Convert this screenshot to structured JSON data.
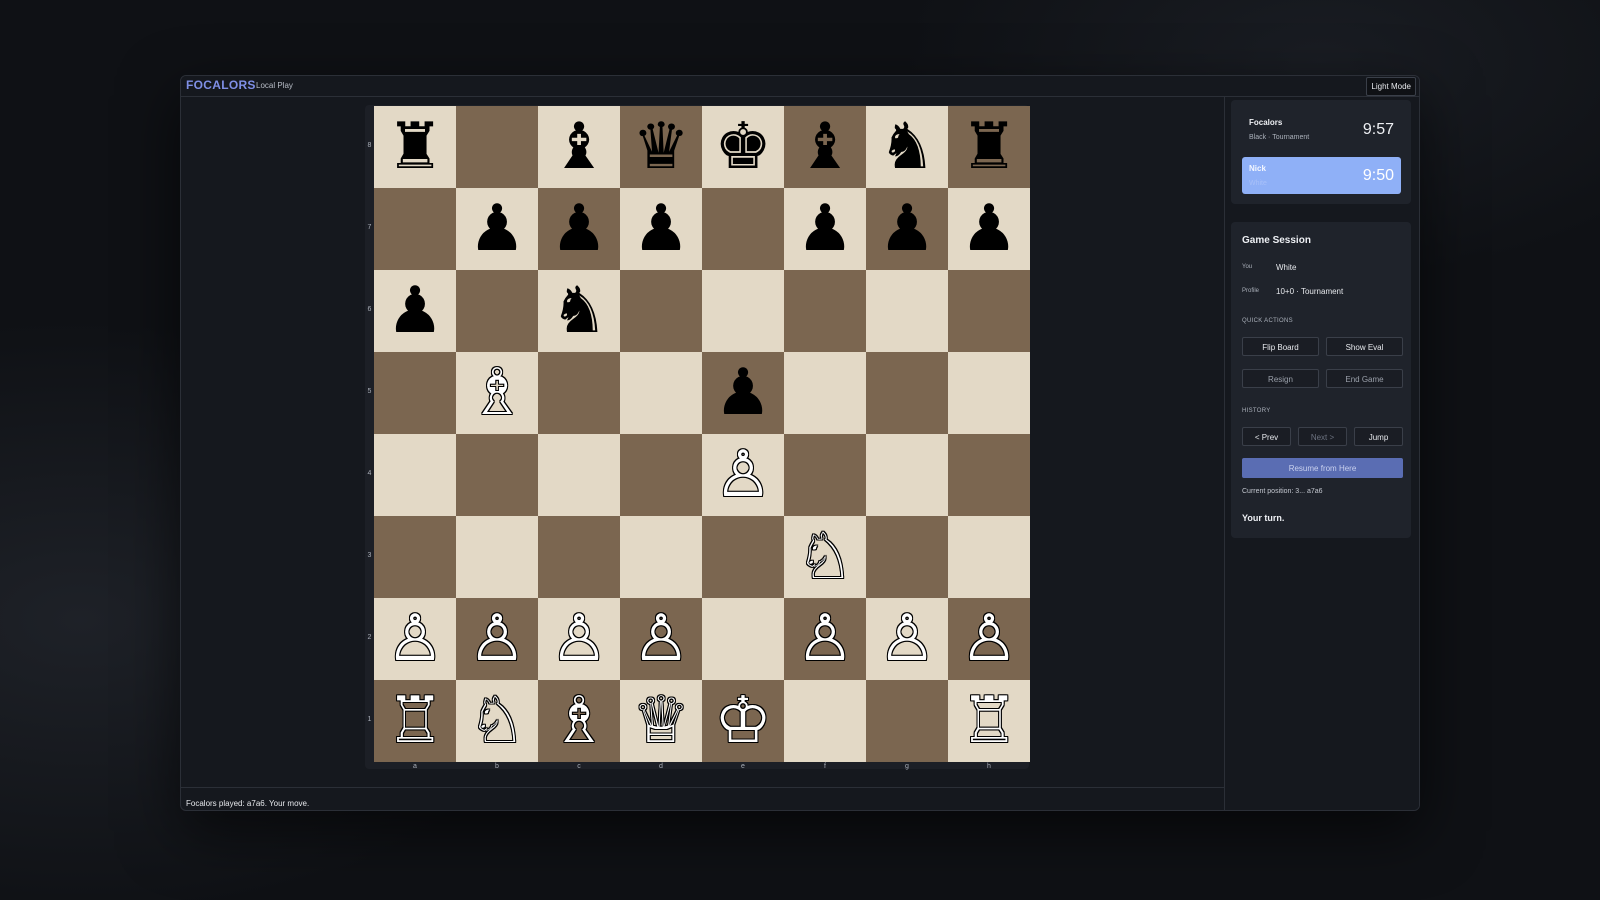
{
  "header": {
    "brand": "FOCALORS",
    "mode": "Local Play",
    "theme_toggle": "Light Mode"
  },
  "board": {
    "rows": [
      [
        "♜",
        "",
        "♝",
        "♛",
        "♚",
        "♝",
        "♞",
        "♜"
      ],
      [
        "",
        "♟",
        "♟",
        "♟",
        "",
        "♟",
        "♟",
        "♟"
      ],
      [
        "♟",
        "",
        "♞",
        "",
        "",
        "",
        "",
        ""
      ],
      [
        "",
        "♗",
        "",
        "",
        "♟",
        "",
        "",
        ""
      ],
      [
        "",
        "",
        "",
        "",
        "♙",
        "",
        "",
        ""
      ],
      [
        "",
        "",
        "",
        "",
        "",
        "♘",
        "",
        ""
      ],
      [
        "♙",
        "♙",
        "♙",
        "♙",
        "",
        "♙",
        "♙",
        "♙"
      ],
      [
        "♖",
        "♘",
        "♗",
        "♕",
        "♔",
        "",
        "",
        "♖"
      ]
    ],
    "ranks": [
      "8",
      "7",
      "6",
      "5",
      "4",
      "3",
      "2",
      "1"
    ],
    "files": [
      "a",
      "b",
      "c",
      "d",
      "e",
      "f",
      "g",
      "h"
    ],
    "light_color": "#e3d9c6",
    "dark_color": "#7b6650"
  },
  "status_message": "Focalors played: a7a6. Your move.",
  "clocks": {
    "opponent": {
      "name": "Focalors",
      "subtitle": "Black · Tournament",
      "time": "9:57"
    },
    "player": {
      "name": "Nick",
      "subtitle": "White",
      "time": "9:50"
    }
  },
  "session": {
    "title": "Game Session",
    "you_label": "You",
    "you_value": "White",
    "profile_label": "Profile",
    "profile_value": "10+0 · Tournament",
    "quick_actions_label": "QUICK ACTIONS",
    "flip_board": "Flip Board",
    "show_eval": "Show Eval",
    "resign": "Resign",
    "end_game": "End Game",
    "history_label": "HISTORY",
    "prev": "< Prev",
    "next": "Next >",
    "jump": "Jump",
    "resume": "Resume from Here",
    "current_position": "Current position: 3... a7a6",
    "turn": "Your turn."
  }
}
